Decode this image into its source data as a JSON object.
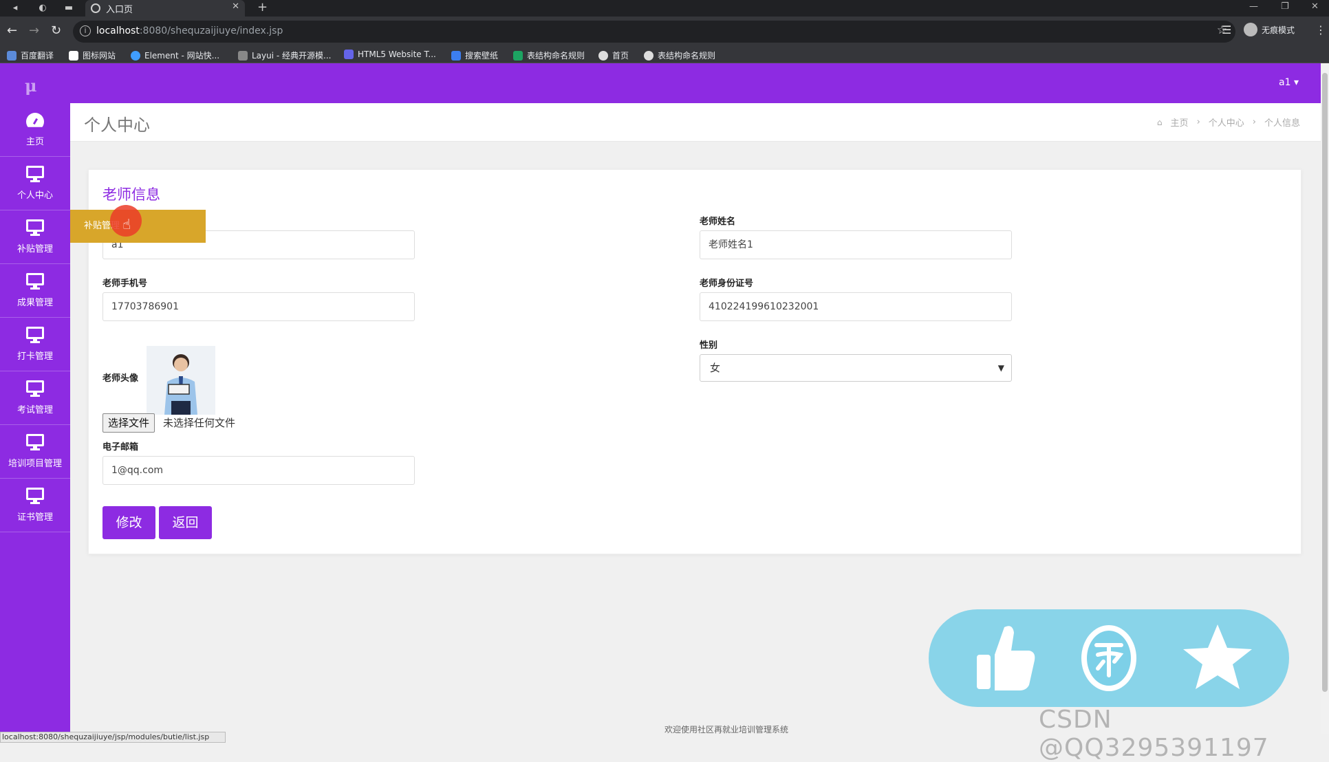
{
  "browser": {
    "tab_title": "入口页",
    "url_host": "localhost",
    "url_path": ":8080/shequzaijiuye/index.jsp",
    "profile_label": "无痕模式",
    "bookmarks": [
      {
        "label": "百度翻译",
        "icon": "baidu-translate-icon"
      },
      {
        "label": "图标网站",
        "icon": "flag-icon"
      },
      {
        "label": "Element - 网站快...",
        "icon": "element-icon"
      },
      {
        "label": "Layui - 经典开源模...",
        "icon": "layui-icon"
      },
      {
        "label": "HTML5 Website T...",
        "icon": "html5-icon"
      },
      {
        "label": "搜索壁纸",
        "icon": "wallpaper-icon"
      },
      {
        "label": "表结构命名规则",
        "icon": "sheet-icon"
      },
      {
        "label": "首页",
        "icon": "globe-icon"
      },
      {
        "label": "表结构命名规则",
        "icon": "globe-icon"
      }
    ],
    "status_url": "localhost:8080/shequzaijiuye/jsp/modules/butie/list.jsp"
  },
  "header": {
    "logo": "μ",
    "user_menu": "a1 ▾"
  },
  "sidebar": {
    "items": [
      {
        "label": "主页",
        "icon": "dashboard-icon"
      },
      {
        "label": "个人中心",
        "icon": "monitor-icon"
      },
      {
        "label": "补贴管理",
        "icon": "monitor-icon"
      },
      {
        "label": "成果管理",
        "icon": "monitor-icon"
      },
      {
        "label": "打卡管理",
        "icon": "monitor-icon"
      },
      {
        "label": "考试管理",
        "icon": "monitor-icon"
      },
      {
        "label": "培训项目管理",
        "icon": "monitor-icon"
      },
      {
        "label": "证书管理",
        "icon": "monitor-icon"
      }
    ],
    "tooltip": "补贴管理"
  },
  "page": {
    "title": "个人中心",
    "breadcrumb": [
      "主页",
      "个人中心",
      "个人信息"
    ]
  },
  "form": {
    "title": "老师信息",
    "account_value": "a1",
    "name_label": "老师姓名",
    "name_value": "老师姓名1",
    "phone_label": "老师手机号",
    "phone_value": "17703786901",
    "idcard_label": "老师身份证号",
    "idcard_value": "410224199610232001",
    "avatar_label": "老师头像",
    "file_button": "选择文件",
    "file_status": "未选择任何文件",
    "gender_label": "性别",
    "gender_value": "女",
    "email_label": "电子邮箱",
    "email_value": "1@qq.com",
    "submit_label": "修改",
    "back_label": "返回"
  },
  "footer": {
    "text": "欢迎使用社区再就业培训管理系统"
  },
  "watermark": "CSDN @QQ3295391197",
  "colors": {
    "brand_purple": "#8d2be2",
    "tooltip_gold": "#d8a62a",
    "overlay_blue": "#7dd0e8"
  }
}
